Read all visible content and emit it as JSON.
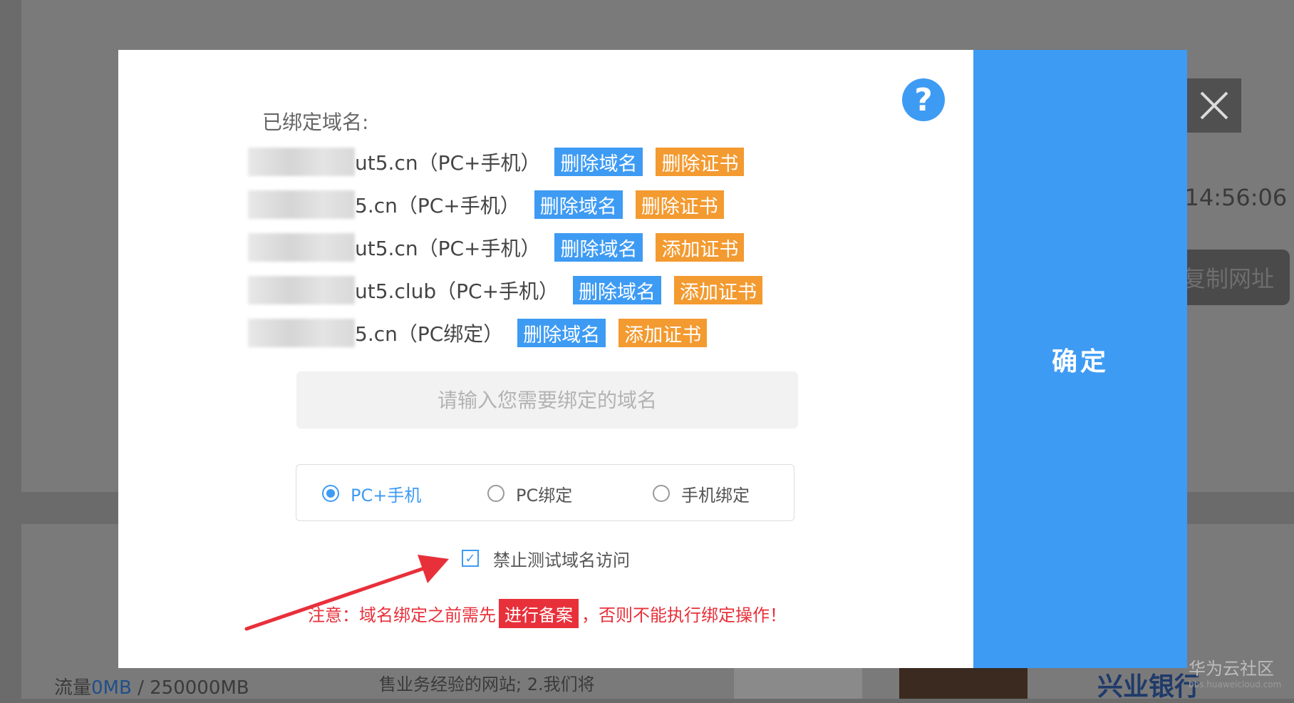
{
  "background": {
    "timestamp": "2 14:56:06",
    "copy_url_label": "复制网址",
    "traffic_prefix": "流量",
    "traffic_used": "0MB",
    "traffic_total": " / 250000MB",
    "snippet": "售业务经验的网站;  2.我们将",
    "bank_logo": "兴业银行"
  },
  "dialog": {
    "help_label": "?",
    "bound_title": "已绑定域名:",
    "domains": [
      {
        "text": "ut5.cn（PC+手机）",
        "actions": [
          "删除域名",
          "删除证书"
        ]
      },
      {
        "text": "5.cn（PC+手机）",
        "actions": [
          "删除域名",
          "删除证书"
        ]
      },
      {
        "text": "ut5.cn（PC+手机）",
        "actions": [
          "删除域名",
          "添加证书"
        ]
      },
      {
        "text": "ut5.club（PC+手机）",
        "actions": [
          "删除域名",
          "添加证书"
        ]
      },
      {
        "text": "5.cn（PC绑定）",
        "actions": [
          "删除域名",
          "添加证书"
        ]
      }
    ],
    "domain_input_placeholder": "请输入您需要绑定的域名",
    "bind_options": [
      "PC+手机",
      "PC绑定",
      "手机绑定"
    ],
    "selected_option": "PC+手机",
    "checkbox_label": "禁止测试域名访问",
    "checkbox_checked": true,
    "notice_before": "注意：域名绑定之前需先",
    "notice_highlight": "进行备案",
    "notice_after": "，否则不能执行绑定操作！",
    "confirm_label": "确定"
  },
  "watermark": {
    "title": "华为云社区",
    "url": "bbs.huaweicloud.com"
  },
  "colors": {
    "accent": "#3e9bf3",
    "orange": "#f39a30",
    "warning": "#e8303a"
  }
}
